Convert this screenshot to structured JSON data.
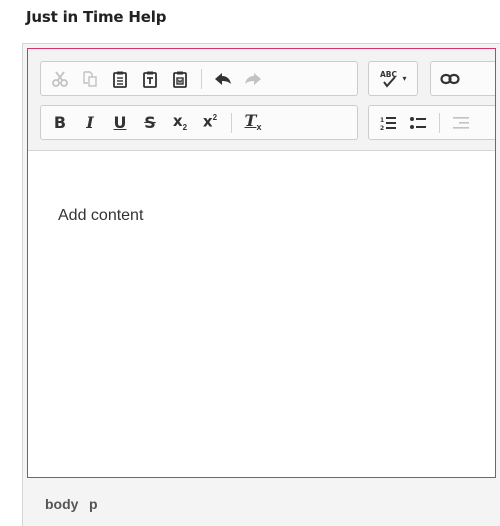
{
  "header": {
    "title": "Just in Time Help"
  },
  "editor": {
    "placeholder": "Add content",
    "toolbar": {
      "clipboard": [
        {
          "name": "cut",
          "icon": "scissors-icon",
          "enabled": false
        },
        {
          "name": "copy",
          "icon": "copy-icon",
          "enabled": false
        },
        {
          "name": "paste",
          "icon": "clipboard-icon",
          "enabled": true
        },
        {
          "name": "paste-as-text",
          "icon": "clipboard-text-icon",
          "enabled": true
        },
        {
          "name": "paste-from-word",
          "icon": "clipboard-word-icon",
          "enabled": true
        }
      ],
      "history": [
        {
          "name": "undo",
          "icon": "undo-icon",
          "enabled": true
        },
        {
          "name": "redo",
          "icon": "redo-icon",
          "enabled": false
        }
      ],
      "spellcheck": {
        "label": "ABC",
        "icon": "spellcheck-icon"
      },
      "link": {
        "icon": "link-icon"
      },
      "basic_styles": [
        {
          "name": "bold",
          "label": "B"
        },
        {
          "name": "italic",
          "label": "I"
        },
        {
          "name": "underline",
          "label": "U"
        },
        {
          "name": "strikethrough",
          "label": "S"
        },
        {
          "name": "subscript",
          "label": "x",
          "index_label": "2"
        },
        {
          "name": "superscript",
          "label": "x",
          "index_label": "2"
        },
        {
          "name": "remove-format",
          "label": "T",
          "index_label": "x"
        }
      ],
      "list": [
        {
          "name": "numbered-list",
          "icon": "numbered-list-icon",
          "labels": [
            "1",
            "2"
          ]
        },
        {
          "name": "bulleted-list",
          "icon": "bulleted-list-icon"
        }
      ]
    },
    "elements_path": [
      "body",
      "p"
    ]
  },
  "colors": {
    "focus_border": "#d6336c",
    "toolbar_bg": "#f3f3f3",
    "icon": "#333333",
    "icon_disabled": "#c2c2c2"
  }
}
